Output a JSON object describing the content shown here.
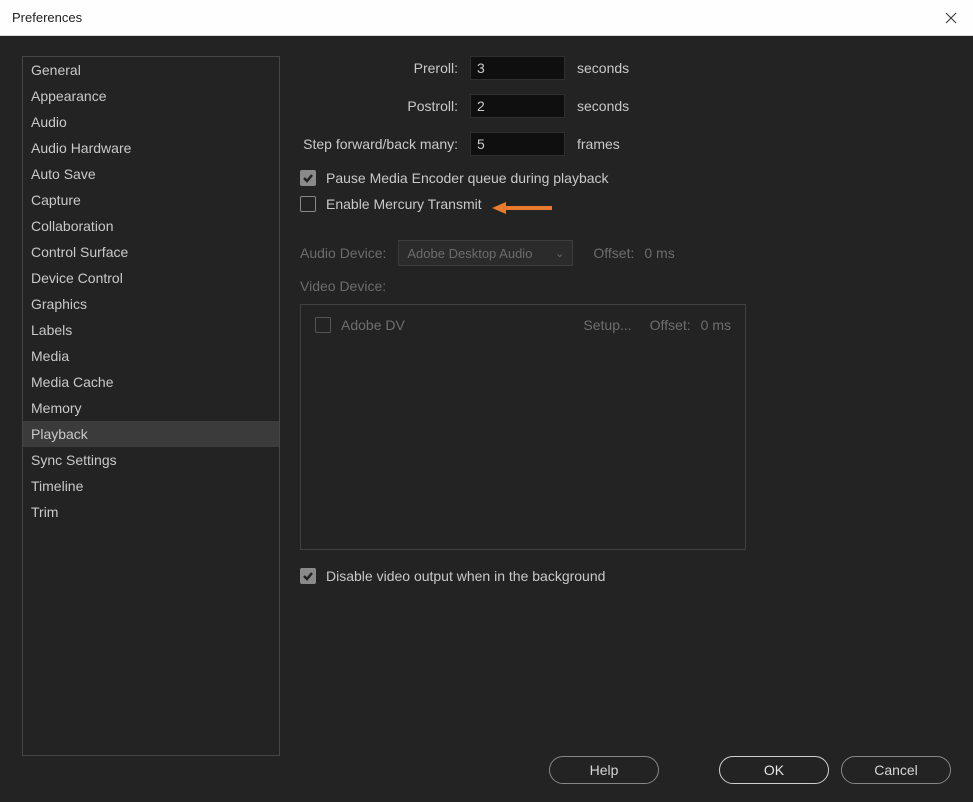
{
  "window": {
    "title": "Preferences"
  },
  "sidebar": {
    "items": [
      "General",
      "Appearance",
      "Audio",
      "Audio Hardware",
      "Auto Save",
      "Capture",
      "Collaboration",
      "Control Surface",
      "Device Control",
      "Graphics",
      "Labels",
      "Media",
      "Media Cache",
      "Memory",
      "Playback",
      "Sync Settings",
      "Timeline",
      "Trim"
    ],
    "selected_index": 14
  },
  "form": {
    "preroll": {
      "label": "Preroll:",
      "value": "3",
      "suffix": "seconds"
    },
    "postroll": {
      "label": "Postroll:",
      "value": "2",
      "suffix": "seconds"
    },
    "step": {
      "label": "Step forward/back many:",
      "value": "5",
      "suffix": "frames"
    }
  },
  "checks": {
    "pause": {
      "label": "Pause Media Encoder queue during playback",
      "checked": true
    },
    "mercury": {
      "label": "Enable Mercury Transmit",
      "checked": false
    },
    "bgvideo": {
      "label": "Disable video output when in the background",
      "checked": true
    }
  },
  "audio": {
    "label": "Audio Device:",
    "value": "Adobe Desktop Audio",
    "offset_label": "Offset:",
    "offset_value": "0 ms"
  },
  "video": {
    "label": "Video Device:",
    "devices": [
      {
        "name": "Adobe DV",
        "setup": "Setup...",
        "offset_label": "Offset:",
        "offset_value": "0 ms"
      }
    ]
  },
  "footer": {
    "help": "Help",
    "ok": "OK",
    "cancel": "Cancel"
  }
}
